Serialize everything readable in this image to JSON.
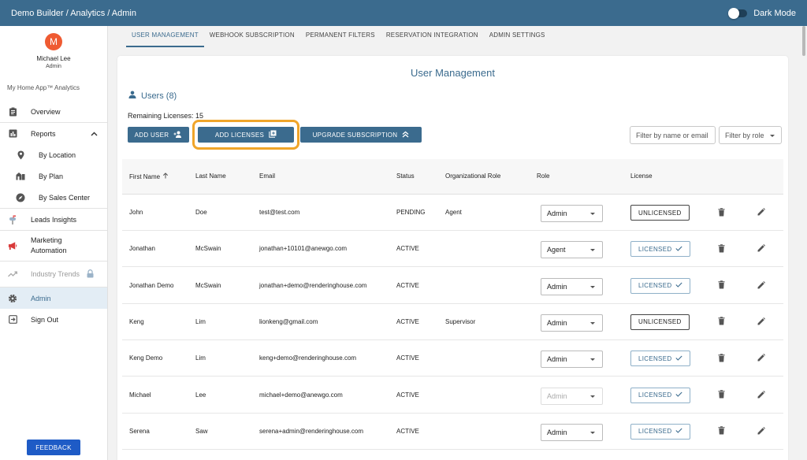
{
  "header": {
    "breadcrumb": "Demo Builder  /  Analytics / Admin",
    "dark_mode_label": "Dark Mode"
  },
  "profile": {
    "initial": "M",
    "name": "Michael Lee",
    "role": "Admin"
  },
  "sidebar": {
    "app_name": "My Home App™ Analytics",
    "items": {
      "overview": "Overview",
      "reports": "Reports",
      "by_location": "By Location",
      "by_plan": "By Plan",
      "by_sales_center": "By Sales Center",
      "leads_insights": "Leads Insights",
      "marketing_1": "Marketing",
      "marketing_2": "Automation",
      "industry_trends": "Industry Trends",
      "admin": "Admin",
      "sign_out": "Sign Out"
    },
    "feedback": "FEEDBACK"
  },
  "tabs": [
    "USER MANAGEMENT",
    "WEBHOOK SUBSCRIPTION",
    "PERMANENT FILTERS",
    "RESERVATION INTEGRATION",
    "ADMIN SETTINGS"
  ],
  "card": {
    "title": "User Management",
    "users_heading": "Users (8)",
    "remaining": "Remaining Licenses: 15",
    "add_user": "ADD USER",
    "add_licenses": "ADD LICENSES",
    "upgrade": "UPGRADE SUBSCRIPTION",
    "filter_name_placeholder": "Filter by name or email",
    "filter_role_placeholder": "Filter by role"
  },
  "table": {
    "headers": [
      "First Name",
      "Last Name",
      "Email",
      "Status",
      "Organizational Role",
      "Role",
      "License"
    ],
    "rows": [
      {
        "first": "John",
        "last": "Doe",
        "email": "test@test.com",
        "status": "PENDING",
        "org_role": "Agent",
        "role": "Admin",
        "role_disabled": false,
        "license": "UNLICENSED",
        "licensed": false
      },
      {
        "first": "Jonathan",
        "last": "McSwain",
        "email": "jonathan+10101@anewgo.com",
        "status": "ACTIVE",
        "org_role": "",
        "role": "Agent",
        "role_disabled": false,
        "license": "LICENSED",
        "licensed": true
      },
      {
        "first": "Jonathan Demo",
        "last": "McSwain",
        "email": "jonathan+demo@renderinghouse.com",
        "status": "ACTIVE",
        "org_role": "",
        "role": "Admin",
        "role_disabled": false,
        "license": "LICENSED",
        "licensed": true
      },
      {
        "first": "Keng",
        "last": "Lim",
        "email": "lionkeng@gmail.com",
        "status": "ACTIVE",
        "org_role": "Supervisor",
        "role": "Admin",
        "role_disabled": false,
        "license": "UNLICENSED",
        "licensed": false
      },
      {
        "first": "Keng Demo",
        "last": "Lim",
        "email": "keng+demo@renderinghouse.com",
        "status": "ACTIVE",
        "org_role": "",
        "role": "Admin",
        "role_disabled": false,
        "license": "LICENSED",
        "licensed": true
      },
      {
        "first": "Michael",
        "last": "Lee",
        "email": "michael+demo@anewgo.com",
        "status": "ACTIVE",
        "org_role": "",
        "role": "Admin",
        "role_disabled": true,
        "license": "LICENSED",
        "licensed": true
      },
      {
        "first": "Serena",
        "last": "Saw",
        "email": "serena+admin@renderinghouse.com",
        "status": "ACTIVE",
        "org_role": "",
        "role": "Admin",
        "role_disabled": false,
        "license": "LICENSED",
        "licensed": true
      }
    ]
  },
  "colors": {
    "primary": "#3b6b8e",
    "highlight": "#f0a52a",
    "avatar": "#ef5b32",
    "feedback": "#1e5bc6"
  }
}
